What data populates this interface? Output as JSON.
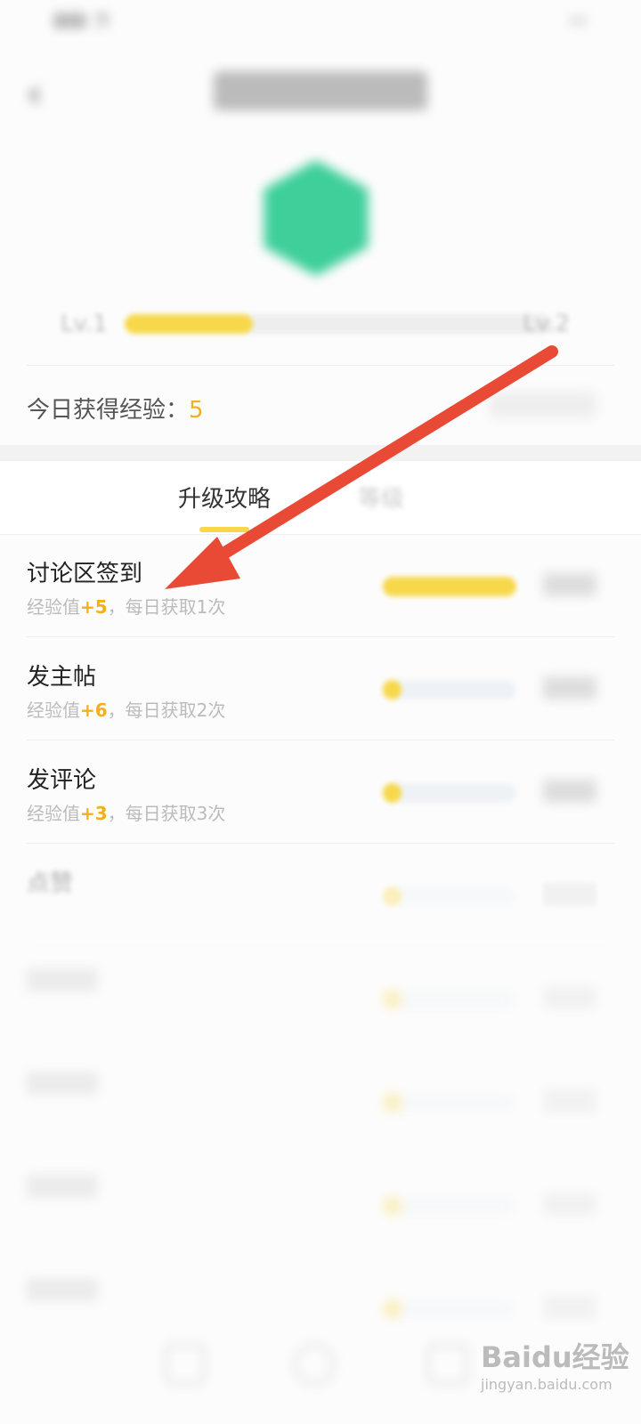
{
  "level": {
    "progress": 0.3
  },
  "today": {
    "label": "今日获得经验：",
    "value": "5"
  },
  "tabs": {
    "active": "升级攻略"
  },
  "tasks": [
    {
      "title": "讨论区签到",
      "desc_prefix": "经验值",
      "exp": "+5",
      "desc_suffix": "，每日获取1次",
      "progress": 1.0
    },
    {
      "title": "发主帖",
      "desc_prefix": "经验值",
      "exp": "+6",
      "desc_suffix": "，每日获取2次",
      "progress": 0.1
    },
    {
      "title": "发评论",
      "desc_prefix": "经验值",
      "exp": "+3",
      "desc_suffix": "，每日获取3次",
      "progress": 0.1
    },
    {
      "title": "点赞",
      "desc_prefix": "",
      "exp": "",
      "desc_suffix": "",
      "progress": 0.1
    },
    {
      "title": "",
      "desc_prefix": "",
      "exp": "",
      "desc_suffix": "",
      "progress": 0.1
    },
    {
      "title": "",
      "desc_prefix": "",
      "exp": "",
      "desc_suffix": "",
      "progress": 0.1
    },
    {
      "title": "",
      "desc_prefix": "",
      "exp": "",
      "desc_suffix": "",
      "progress": 0.1
    },
    {
      "title": "",
      "desc_prefix": "",
      "exp": "",
      "desc_suffix": "",
      "progress": 0.1
    }
  ],
  "annotation": {
    "arrow_color": "#e84a35"
  },
  "colors": {
    "accent": "#f7d84a",
    "avatar": "#3ecf9a",
    "exp": "#f2b01c"
  }
}
